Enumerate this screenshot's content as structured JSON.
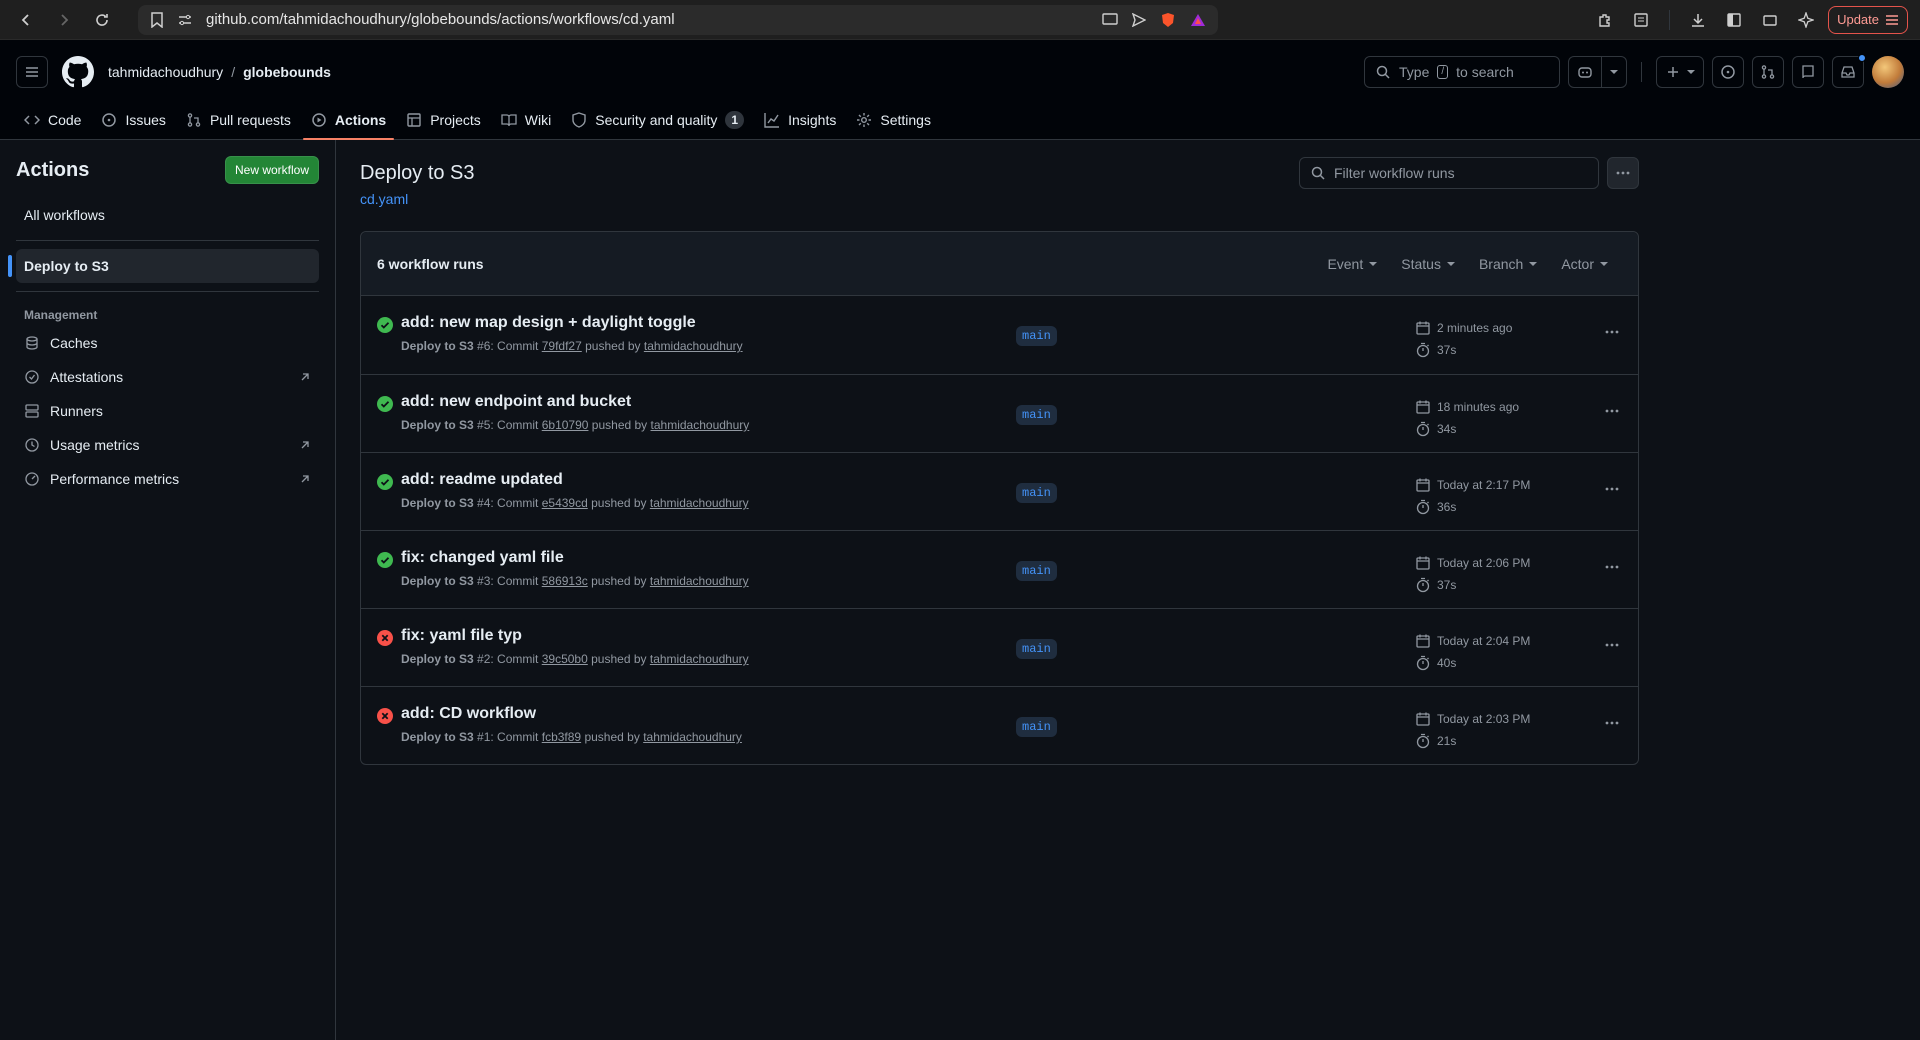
{
  "browser": {
    "url": "github.com/tahmidachoudhury/globebounds/actions/workflows/cd.yaml",
    "update_label": "Update"
  },
  "header": {
    "owner": "tahmidachoudhury",
    "separator": "/",
    "repo": "globebounds",
    "search": {
      "prefix": "Type",
      "key": "/",
      "suffix": "to search"
    }
  },
  "tabs": [
    {
      "label": "Code"
    },
    {
      "label": "Issues"
    },
    {
      "label": "Pull requests"
    },
    {
      "label": "Actions"
    },
    {
      "label": "Projects"
    },
    {
      "label": "Wiki"
    },
    {
      "label": "Security and quality",
      "count": "1"
    },
    {
      "label": "Insights"
    },
    {
      "label": "Settings"
    }
  ],
  "sidebar": {
    "title": "Actions",
    "new_workflow": "New workflow",
    "all_workflows": "All workflows",
    "selected_workflow": "Deploy to S3",
    "management_label": "Management",
    "management": [
      {
        "label": "Caches"
      },
      {
        "label": "Attestations"
      },
      {
        "label": "Runners"
      },
      {
        "label": "Usage metrics"
      },
      {
        "label": "Performance metrics"
      }
    ]
  },
  "main": {
    "title": "Deploy to S3",
    "file": "cd.yaml",
    "filter_placeholder": "Filter workflow runs",
    "runs_count": "6 workflow runs",
    "filters": [
      "Event",
      "Status",
      "Branch",
      "Actor"
    ],
    "runs": [
      {
        "title": "add: new map design + daylight toggle",
        "workflow": "Deploy to S3",
        "number": "#6: Commit",
        "sha": "79fdf27",
        "pushed": "pushed by",
        "user": "tahmidachoudhury",
        "branch": "main",
        "when": "2 minutes ago",
        "duration": "37s",
        "status": "success"
      },
      {
        "title": "add: new endpoint and bucket",
        "workflow": "Deploy to S3",
        "number": "#5: Commit",
        "sha": "6b10790",
        "pushed": "pushed by",
        "user": "tahmidachoudhury",
        "branch": "main",
        "when": "18 minutes ago",
        "duration": "34s",
        "status": "success"
      },
      {
        "title": "add: readme updated",
        "workflow": "Deploy to S3",
        "number": "#4: Commit",
        "sha": "e5439cd",
        "pushed": "pushed by",
        "user": "tahmidachoudhury",
        "branch": "main",
        "when": "Today at 2:17 PM",
        "duration": "36s",
        "status": "success"
      },
      {
        "title": "fix: changed yaml file",
        "workflow": "Deploy to S3",
        "number": "#3: Commit",
        "sha": "586913c",
        "pushed": "pushed by",
        "user": "tahmidachoudhury",
        "branch": "main",
        "when": "Today at 2:06 PM",
        "duration": "37s",
        "status": "success"
      },
      {
        "title": "fix: yaml file typ",
        "workflow": "Deploy to S3",
        "number": "#2: Commit",
        "sha": "39c50b0",
        "pushed": "pushed by",
        "user": "tahmidachoudhury",
        "branch": "main",
        "when": "Today at 2:04 PM",
        "duration": "40s",
        "status": "failure"
      },
      {
        "title": "add: CD workflow",
        "workflow": "Deploy to S3",
        "number": "#1: Commit",
        "sha": "fcb3f89",
        "pushed": "pushed by",
        "user": "tahmidachoudhury",
        "branch": "main",
        "when": "Today at 2:03 PM",
        "duration": "21s",
        "status": "failure"
      }
    ]
  },
  "colors": {
    "success": "#3fb950",
    "failure": "#f85149",
    "accent": "#4493f8",
    "tab_underline": "#f78166",
    "primary_button": "#238636"
  }
}
